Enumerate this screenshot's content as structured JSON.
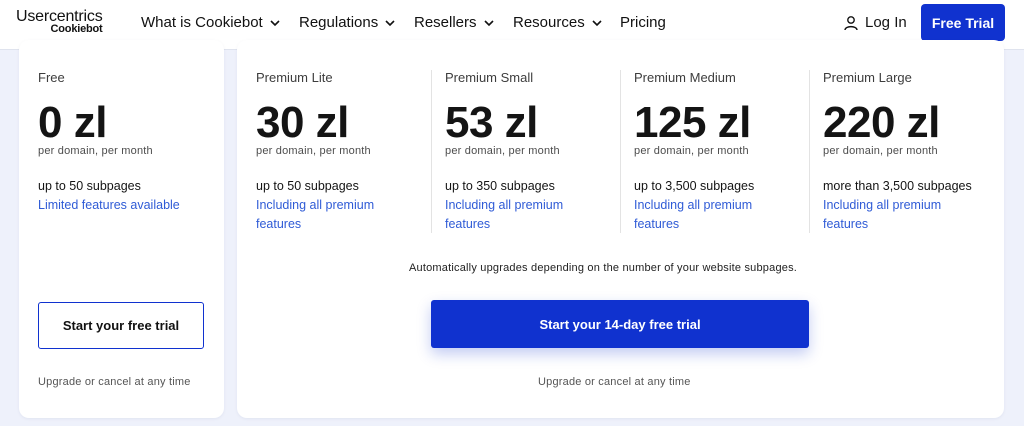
{
  "header": {
    "logo_top": "Usercentrics",
    "logo_sub": "Cookiebot",
    "nav": [
      {
        "label": "What is Cookiebot"
      },
      {
        "label": "Regulations"
      },
      {
        "label": "Resellers"
      },
      {
        "label": "Resources"
      },
      {
        "label": "Pricing"
      }
    ],
    "login_label": "Log In",
    "free_trial_label": "Free Trial",
    "accent_color": "#1032cf"
  },
  "plans": {
    "free": {
      "name": "Free",
      "price": "0 zl",
      "period": "per domain, per month",
      "limit": "up to 50 subpages",
      "features": "Limited features available",
      "cta": "Start your free trial",
      "note": "Upgrade or cancel at any time"
    },
    "premium": [
      {
        "name": "Premium Lite",
        "price": "30 zl",
        "period": "per domain, per month",
        "limit": "up to 50 subpages",
        "features": "Including all premium features"
      },
      {
        "name": "Premium Small",
        "price": "53 zl",
        "period": "per domain, per month",
        "limit": "up to 350 subpages",
        "features": "Including all premium features"
      },
      {
        "name": "Premium Medium",
        "price": "125 zl",
        "period": "per domain, per month",
        "limit": "up to 3,500 subpages",
        "features": "Including all premium features"
      },
      {
        "name": "Premium Large",
        "price": "220 zl",
        "period": "per domain, per month",
        "limit": "more than 3,500 subpages",
        "features": "Including all premium features"
      }
    ],
    "premium_auto_note": "Automatically upgrades depending on the number of your website subpages.",
    "premium_cta": "Start your 14-day free trial",
    "premium_note": "Upgrade or cancel at any time"
  }
}
